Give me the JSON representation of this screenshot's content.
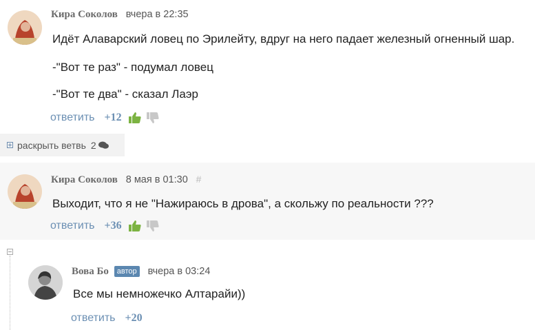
{
  "comments": [
    {
      "author": "Кира Соколов",
      "date": "вчера в 22:35",
      "lines": [
        "Идёт Алаварский ловец по Эрилейту, вдруг на него падает железный огненный шар.",
        "-\"Вот те раз\" - подумал ловец",
        "-\"Вот те два\" - сказал Лаэр"
      ],
      "reply_label": "ответить",
      "score": "+12"
    },
    {
      "author": "Кира Соколов",
      "date": "8 мая в 01:30",
      "hash": "#",
      "lines": [
        "Выходит, что я не \"Нажираюсь в дрова\", а скольжу по реальности ???"
      ],
      "reply_label": "ответить",
      "score": "+36"
    },
    {
      "author": "Вова Бо",
      "badge": "автор",
      "date": "вчера в 03:24",
      "lines": [
        "Все мы немножечко Алтарайи))"
      ],
      "reply_label": "ответить",
      "score": "+20"
    }
  ],
  "expand_thread": {
    "label": "раскрыть ветвь",
    "count": "2"
  },
  "colors": {
    "link": "#6b8fb3",
    "thumb_up": "#7cb342",
    "thumb_down": "#c8c8c8",
    "highlight_bg": "#f7f7f7",
    "badge_bg": "#5b87b0"
  },
  "icons": [
    "thumb-up-icon",
    "thumb-down-icon",
    "plus-square-icon",
    "minus-square-icon",
    "chat-bubble-icon"
  ]
}
